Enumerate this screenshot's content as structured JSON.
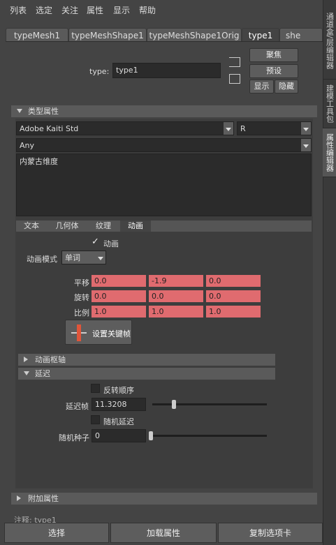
{
  "menu": [
    "列表",
    "选定",
    "关注",
    "属性",
    "显示",
    "帮助"
  ],
  "right_tabs": [
    "通道盒/层编辑器",
    "建模工具包",
    "属性编辑器"
  ],
  "node_tabs": [
    "typeMesh1",
    "typeMeshShape1",
    "typeMeshShape1Orig",
    "type1",
    "she"
  ],
  "type_label": "type:",
  "type_value": "type1",
  "buttons": {
    "focus": "聚焦",
    "preset": "预设",
    "show": "显示",
    "hide": "隐藏"
  },
  "section_type_attrs": "类型属性",
  "font_dropdown": "Adobe Kaiti Std",
  "style_dropdown": "R",
  "writing_system": "Any",
  "text_content": "内蒙古维度",
  "property_tabs": [
    "文本",
    "几何体",
    "纹理",
    "动画"
  ],
  "animation": {
    "animate_label": "动画",
    "mode_label": "动画模式",
    "mode_value": "单词",
    "translate_label": "平移",
    "translate": [
      "0.0",
      "-1.9",
      "0.0"
    ],
    "rotate_label": "旋转",
    "rotate": [
      "0.0",
      "0.0",
      "0.0"
    ],
    "scale_label": "比例",
    "scale": [
      "1.0",
      "1.0",
      "1.0"
    ],
    "set_key_label": "设置关键帧"
  },
  "section_pivot": "动画枢轴",
  "section_delay": "延迟",
  "delay": {
    "reverse_label": "反转顺序",
    "delay_frames_label": "延迟帧",
    "delay_frames_value": "11.3208",
    "delay_slider_fraction": 0.18,
    "random_delay_label": "随机延迟",
    "random_seed_label": "随机种子",
    "random_seed_value": "0",
    "seed_slider_fraction": 0.0
  },
  "section_extra": "附加属性",
  "notes_label": "注释: type1",
  "bottom_buttons": [
    "选择",
    "加载属性",
    "复制选项卡"
  ],
  "colors": {
    "pink_field": "#e06b6f",
    "panel": "#444444"
  }
}
